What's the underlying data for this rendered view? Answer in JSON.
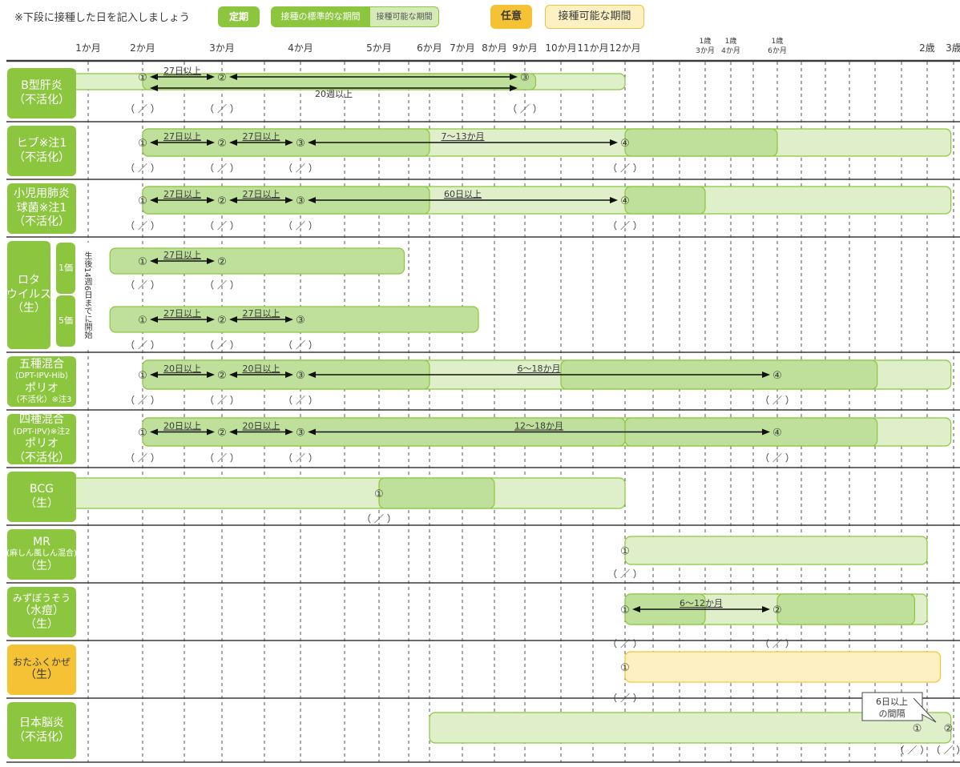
{
  "header": {
    "note": "※下段に接種した日を記入しましょう",
    "legend_teiki": "定期",
    "legend_standard": "接種の標準的な期間",
    "legend_possible": "接種可能な期間",
    "legend_nini": "任意",
    "legend_nini_possible": "接種可能な期間"
  },
  "colors": {
    "routine_dark": "#8cc63f",
    "routine_band": "#bfe09a",
    "routine_light": "#deefca",
    "optional_dark": "#f5c236",
    "optional_light": "#fdf0c2",
    "separator": "#3a3a3a"
  },
  "chart_data": {
    "type": "table",
    "columns": [
      {
        "label": "1か月"
      },
      {
        "label": "2か月"
      },
      {
        "label": "3か月"
      },
      {
        "label": "4か月"
      },
      {
        "label": "5か月"
      },
      {
        "label": "6か月"
      },
      {
        "label": "7か月"
      },
      {
        "label": "8か月"
      },
      {
        "label": "9か月"
      },
      {
        "label": "10か月"
      },
      {
        "label": "11か月"
      },
      {
        "label": "12か月"
      },
      {
        "label": "1歳\n3か月"
      },
      {
        "label": "1歳\n4か月"
      },
      {
        "label": "1歳\n6か月"
      },
      {
        "label": "2歳"
      },
      {
        "label": "3歳"
      }
    ],
    "date_blank": "（ ／ ）",
    "rows": [
      {
        "label": [
          "B型肝炎",
          "（不活化）"
        ],
        "category": "routine",
        "bands": [
          {
            "from": 0.1,
            "to": 12.0,
            "kind": "possible"
          },
          {
            "from": 2.0,
            "to": 9.3,
            "kind": "standard"
          }
        ],
        "doses": [
          {
            "n": "①",
            "at": 2.0
          },
          {
            "n": "②",
            "at": 3.0
          },
          {
            "n": "③",
            "at": 9.0
          }
        ],
        "intervals": [
          {
            "from": 2.0,
            "to": 3.0,
            "text": "27日以上",
            "above": true
          },
          {
            "from": 3.0,
            "to": 9.0,
            "text": "",
            "above": true
          },
          {
            "from": 2.0,
            "to": 9.0,
            "text": "20週以上",
            "above": false
          }
        ],
        "dates": [
          2.0,
          3.0,
          9.0
        ]
      },
      {
        "label": [
          "ヒブ※注1",
          "（不活化）"
        ],
        "category": "routine",
        "bands": [
          {
            "from": 2.0,
            "to": 24.9,
            "kind": "possible"
          },
          {
            "from": 2.0,
            "to": 6.0,
            "kind": "standard"
          },
          {
            "from": 12.0,
            "to": 18.0,
            "kind": "standard"
          }
        ],
        "doses": [
          {
            "n": "①",
            "at": 2.0
          },
          {
            "n": "②",
            "at": 3.0
          },
          {
            "n": "③",
            "at": 4.0
          },
          {
            "n": "④",
            "at": 12.0
          }
        ],
        "intervals": [
          {
            "from": 2.0,
            "to": 3.0,
            "text": "27日以上",
            "above": true
          },
          {
            "from": 3.0,
            "to": 4.0,
            "text": "27日以上",
            "above": true
          },
          {
            "from": 4.0,
            "to": 12.0,
            "text": "7〜13か月",
            "above": true
          }
        ],
        "dates": [
          2.0,
          3.0,
          4.0,
          12.0
        ]
      },
      {
        "label": [
          "小児用肺炎",
          "球菌※注1",
          "（不活化）"
        ],
        "category": "routine",
        "bands": [
          {
            "from": 2.0,
            "to": 24.9,
            "kind": "possible"
          },
          {
            "from": 2.0,
            "to": 6.0,
            "kind": "standard"
          },
          {
            "from": 12.0,
            "to": 15.0,
            "kind": "standard"
          }
        ],
        "doses": [
          {
            "n": "①",
            "at": 2.0
          },
          {
            "n": "②",
            "at": 3.0
          },
          {
            "n": "③",
            "at": 4.0
          },
          {
            "n": "④",
            "at": 12.0
          }
        ],
        "intervals": [
          {
            "from": 2.0,
            "to": 3.0,
            "text": "27日以上",
            "above": true
          },
          {
            "from": 3.0,
            "to": 4.0,
            "text": "27日以上",
            "above": true
          },
          {
            "from": 4.0,
            "to": 12.0,
            "text": "60日以上",
            "above": true
          }
        ],
        "dates": [
          2.0,
          3.0,
          4.0,
          12.0
        ]
      },
      {
        "label": [
          "ロタ",
          "ウイルス",
          "（生）"
        ],
        "category": "routine",
        "sub_labels": [
          "1価",
          "5価"
        ],
        "side_note": "生後14週6日までに開始",
        "subrows": [
          {
            "bands": [
              {
                "from": 1.4,
                "to": 5.5,
                "kind": "standard"
              }
            ],
            "doses": [
              {
                "n": "①",
                "at": 2.0
              },
              {
                "n": "②",
                "at": 3.0
              }
            ],
            "intervals": [
              {
                "from": 2.0,
                "to": 3.0,
                "text": "27日以上",
                "above": true
              }
            ],
            "dates": [
              2.0,
              3.0
            ]
          },
          {
            "bands": [
              {
                "from": 1.4,
                "to": 7.5,
                "kind": "standard"
              }
            ],
            "doses": [
              {
                "n": "①",
                "at": 2.0
              },
              {
                "n": "②",
                "at": 3.0
              },
              {
                "n": "③",
                "at": 4.0
              }
            ],
            "intervals": [
              {
                "from": 2.0,
                "to": 3.0,
                "text": "27日以上",
                "above": true
              },
              {
                "from": 3.0,
                "to": 4.0,
                "text": "27日以上",
                "above": true
              }
            ],
            "dates": [
              2.0,
              3.0,
              4.0
            ]
          }
        ]
      },
      {
        "label": [
          "五種混合",
          "(DPT-IPV-Hib)",
          "ポリオ",
          "（不活化）※注3"
        ],
        "category": "routine",
        "bands": [
          {
            "from": 2.0,
            "to": 24.9,
            "kind": "possible"
          },
          {
            "from": 2.0,
            "to": 6.0,
            "kind": "standard"
          },
          {
            "from": 10.0,
            "to": 22.0,
            "kind": "standard"
          }
        ],
        "doses": [
          {
            "n": "①",
            "at": 2.0
          },
          {
            "n": "②",
            "at": 3.0
          },
          {
            "n": "③",
            "at": 4.0
          },
          {
            "n": "④",
            "at": 18.0
          }
        ],
        "intervals": [
          {
            "from": 2.0,
            "to": 3.0,
            "text": "20日以上",
            "above": true
          },
          {
            "from": 3.0,
            "to": 4.0,
            "text": "20日以上",
            "above": true
          },
          {
            "from": 4.0,
            "to": 18.0,
            "text": "6〜18か月",
            "above": true
          }
        ],
        "dates": [
          2.0,
          3.0,
          4.0,
          18.0
        ]
      },
      {
        "label": [
          "四種混合",
          "(DPT-IPV)※注2",
          "ポリオ",
          "（不活化）"
        ],
        "category": "routine",
        "bands": [
          {
            "from": 2.0,
            "to": 24.9,
            "kind": "possible"
          },
          {
            "from": 2.0,
            "to": 12.0,
            "kind": "standard"
          },
          {
            "from": 12.0,
            "to": 22.0,
            "kind": "standard"
          }
        ],
        "doses": [
          {
            "n": "①",
            "at": 2.0
          },
          {
            "n": "②",
            "at": 3.0
          },
          {
            "n": "③",
            "at": 4.0
          },
          {
            "n": "④",
            "at": 18.0
          }
        ],
        "intervals": [
          {
            "from": 2.0,
            "to": 3.0,
            "text": "20日以上",
            "above": true
          },
          {
            "from": 3.0,
            "to": 4.0,
            "text": "20日以上",
            "above": true
          },
          {
            "from": 4.0,
            "to": 18.0,
            "text": "12〜18か月",
            "above": true
          }
        ],
        "dates": [
          2.0,
          3.0,
          4.0,
          18.0
        ]
      },
      {
        "label": [
          "BCG",
          "（生）"
        ],
        "category": "routine",
        "bands": [
          {
            "from": 0.1,
            "to": 12.0,
            "kind": "possible"
          },
          {
            "from": 5.0,
            "to": 8.0,
            "kind": "standard"
          }
        ],
        "doses": [
          {
            "n": "①",
            "at": 5.0
          }
        ],
        "intervals": [],
        "dates": [
          5.0
        ]
      },
      {
        "label": [
          "MR",
          "(麻しん風しん混合)",
          "（生）"
        ],
        "category": "routine",
        "bands": [
          {
            "from": 12.0,
            "to": 24.0,
            "kind": "possible"
          }
        ],
        "doses": [
          {
            "n": "①",
            "at": 12.0
          }
        ],
        "intervals": [],
        "dates": [
          12.0
        ]
      },
      {
        "label": [
          "みずぼうそう",
          "（水痘）",
          "（生）"
        ],
        "category": "routine",
        "bands": [
          {
            "from": 12.0,
            "to": 24.0,
            "kind": "possible"
          },
          {
            "from": 12.0,
            "to": 15.0,
            "kind": "standard"
          },
          {
            "from": 18.0,
            "to": 23.5,
            "kind": "standard"
          }
        ],
        "doses": [
          {
            "n": "①",
            "at": 12.0
          },
          {
            "n": "②",
            "at": 18.0
          }
        ],
        "intervals": [
          {
            "from": 12.0,
            "to": 18.0,
            "text": "6〜12か月",
            "above": true
          }
        ],
        "dates": [
          12.0,
          18.0
        ]
      },
      {
        "label": [
          "おたふくかぜ",
          "（生）"
        ],
        "category": "optional",
        "bands": [
          {
            "from": 12.0,
            "to": 24.5,
            "kind": "optional"
          }
        ],
        "doses": [
          {
            "n": "①",
            "at": 12.0
          }
        ],
        "intervals": [],
        "dates": [
          12.0
        ]
      },
      {
        "label": [
          "日本脳炎",
          "（不活化）"
        ],
        "category": "routine",
        "bands": [
          {
            "from": 6.0,
            "to": 24.9,
            "kind": "possible"
          }
        ],
        "doses": [
          {
            "n": "①",
            "at": 23.6
          },
          {
            "n": "②",
            "at": 24.8
          }
        ],
        "intervals": [],
        "callout": [
          "6日以上",
          "の間隔"
        ],
        "dates": [
          23.4,
          24.8
        ]
      }
    ]
  }
}
